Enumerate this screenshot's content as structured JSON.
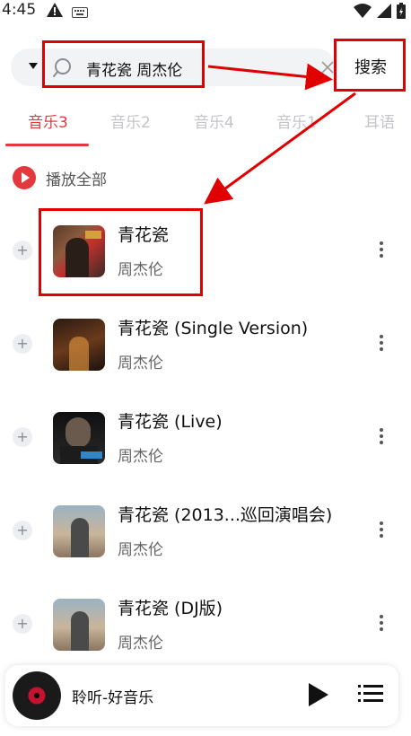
{
  "status": {
    "time": "4:45"
  },
  "search": {
    "query": "青花瓷 周杰伦",
    "button": "搜索"
  },
  "tabs": [
    {
      "label": "音乐3"
    },
    {
      "label": "音乐2"
    },
    {
      "label": "音乐4"
    },
    {
      "label": "音乐1"
    },
    {
      "label": "耳语"
    }
  ],
  "play_all": {
    "label": "播放全部"
  },
  "songs": [
    {
      "title": "青花瓷",
      "artist": "周杰伦"
    },
    {
      "title": "青花瓷 (Single Version)",
      "artist": "周杰伦"
    },
    {
      "title": "青花瓷 (Live)",
      "artist": "周杰伦"
    },
    {
      "title": "青花瓷 (2013...巡回演唱会)",
      "artist": "周杰伦"
    },
    {
      "title": "青花瓷 (DJ版)",
      "artist": "周杰伦"
    }
  ],
  "player": {
    "title": "聆听-好音乐"
  },
  "colors": {
    "accent": "#e4393c",
    "annotation": "#e00000"
  }
}
